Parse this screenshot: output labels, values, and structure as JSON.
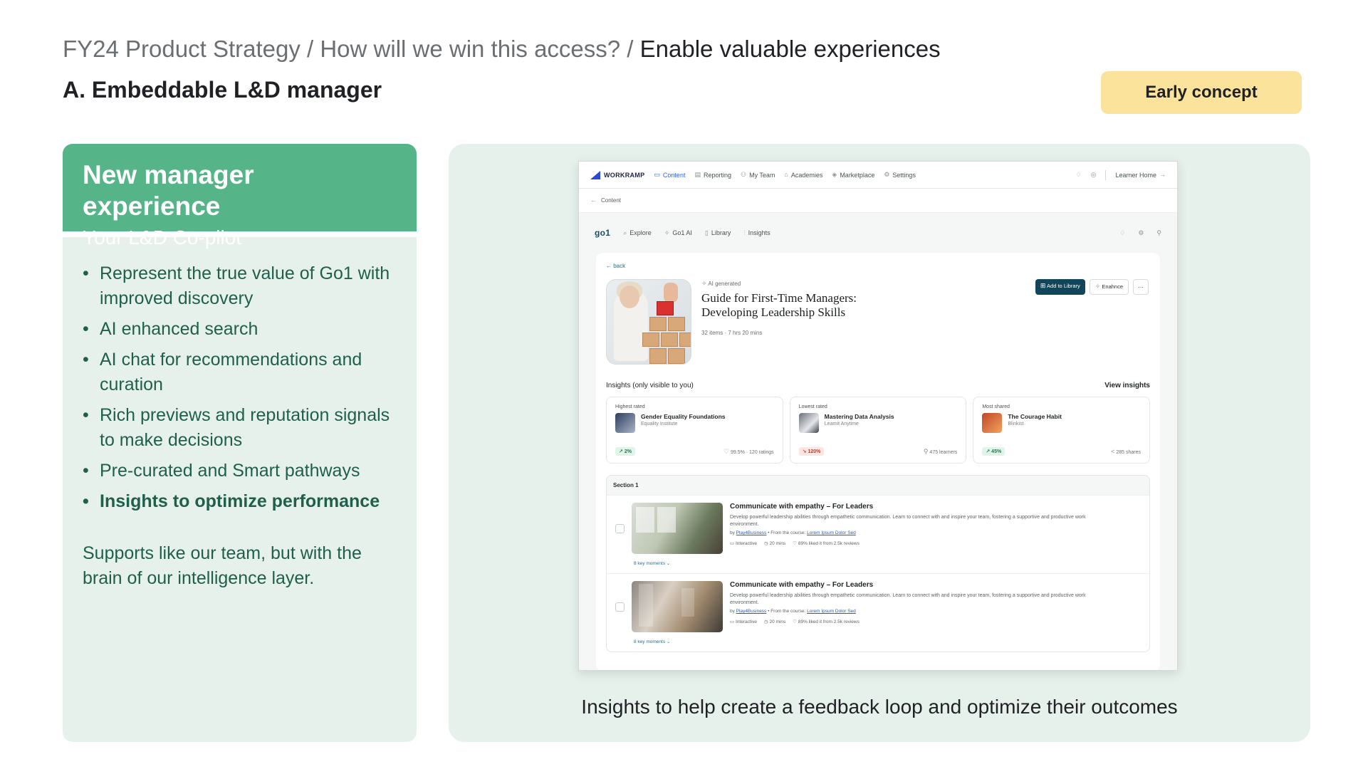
{
  "header": {
    "breadcrumb_path": "FY24 Product Strategy / How will we win this access? / ",
    "breadcrumb_current": "Enable valuable experiences",
    "subtitle": "A. Embeddable L&D manager",
    "badge": "Early concept"
  },
  "left_card": {
    "title": "New manager experience",
    "tagline": "Your L&D Co-pilot",
    "bullets": [
      "Represent the true value of Go1 with improved discovery",
      "AI enhanced search",
      "AI chat for recommendations and curation",
      "Rich previews and reputation signals to make decisions",
      "Pre-curated and Smart pathways",
      "Insights to optimize performance"
    ],
    "footer": "Supports like our team, but with the brain of our intelligence layer."
  },
  "caption": "Insights to help create a feedback loop and optimize their outcomes",
  "mock": {
    "topbar": {
      "logo": "WORKRAMP",
      "nav": [
        "Content",
        "Reporting",
        "My Team",
        "Academies",
        "Marketplace",
        "Settings"
      ],
      "learner_home": "Learner Home"
    },
    "crumb": "Content",
    "go1bar": {
      "logo": "go1",
      "nav": [
        "Explore",
        "Go1 AI",
        "Library",
        "Insights"
      ]
    },
    "back": "back",
    "course": {
      "tag": "AI generated",
      "title": "Guide for First-Time Managers: Developing Leadership Skills",
      "items": "32 items",
      "duration": "7 hrs 20 mins",
      "add_label": "Add to Library",
      "enhance_label": "Enahnce",
      "more_label": "···"
    },
    "insights": {
      "heading": "Insights (only visible to you)",
      "view_link": "View insights",
      "cards": [
        {
          "label": "Highest rated",
          "name": "Gender Equality Foundations",
          "provider": "Equality Institute",
          "change": "2%",
          "stat": "99.5% · 120 ratings"
        },
        {
          "label": "Lowest rated",
          "name": "Mastering Data Analysis",
          "provider": "Learnit Anytime",
          "change": "120%",
          "stat": "475 learners"
        },
        {
          "label": "Most shared",
          "name": "The Courage Habit",
          "provider": "Blinkist",
          "change": "45%",
          "stat": "285 shares"
        }
      ]
    },
    "section": {
      "title": "Section 1",
      "lessons": [
        {
          "title": "Communicate with empathy – For Leaders",
          "desc": "Develop powerful leadership abilities through empathetic communication. Learn to connect with and inspire your team, fostering a supportive and productive work environment.",
          "by_prefix": "by ",
          "by_link": "Play4Business",
          "from_prefix": " • From the course: ",
          "from_link": "Lorem Ipsum Dolor Sed",
          "type": "Interactive",
          "duration": "20 mins",
          "likes": "89% liked it from 2.5k reviews",
          "moments": "8 key moments"
        },
        {
          "title": "Communicate with empathy – For Leaders",
          "desc": "Develop powerful leadership abilities through empathetic communication. Learn to connect with and inspire your team, fostering a supportive and productive work environment.",
          "by_prefix": "by ",
          "by_link": "Play4Business",
          "from_prefix": " • From the course: ",
          "from_link": "Lorem Ipsum Dolor Sed",
          "type": "Interactive",
          "duration": "20 mins",
          "likes": "89% liked it from 2.5k reviews",
          "moments": "8 key moments"
        }
      ]
    }
  },
  "colors": {
    "accent_green": "#55b488",
    "card_bg": "#e7f1ec",
    "badge_yellow": "#fbe39b",
    "text_green": "#1f5f4c",
    "primary_button": "#11465a"
  }
}
